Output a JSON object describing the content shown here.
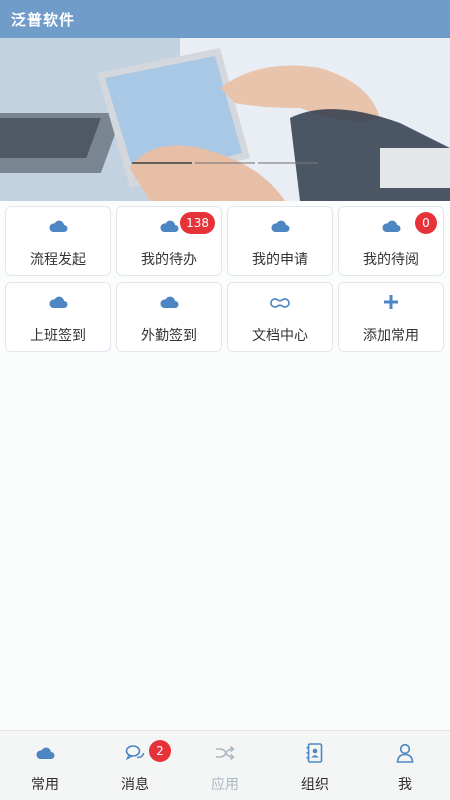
{
  "header": {
    "title": "泛普软件"
  },
  "grid": {
    "items": [
      {
        "label": "流程发起",
        "icon": "cloud-icon"
      },
      {
        "label": "我的待办",
        "icon": "cloud-icon",
        "badge": "138"
      },
      {
        "label": "我的申请",
        "icon": "cloud-icon"
      },
      {
        "label": "我的待阅",
        "icon": "cloud-icon",
        "badge": "0"
      },
      {
        "label": "上班签到",
        "icon": "cloud-icon"
      },
      {
        "label": "外勤签到",
        "icon": "cloud-icon"
      },
      {
        "label": "文档中心",
        "icon": "cloud-outline-icon"
      },
      {
        "label": "添加常用",
        "icon": "plus-icon"
      }
    ]
  },
  "tabbar": {
    "items": [
      {
        "label": "常用",
        "icon": "cloud-icon"
      },
      {
        "label": "消息",
        "icon": "chat-icon",
        "badge": "2"
      },
      {
        "label": "应用",
        "icon": "shuffle-icon"
      },
      {
        "label": "组织",
        "icon": "contacts-icon"
      },
      {
        "label": "我",
        "icon": "user-icon"
      }
    ]
  },
  "colors": {
    "accent": "#6f9cc9",
    "icon": "#4e86c3",
    "badge": "#e63339",
    "inactive": "#aab8c6"
  }
}
